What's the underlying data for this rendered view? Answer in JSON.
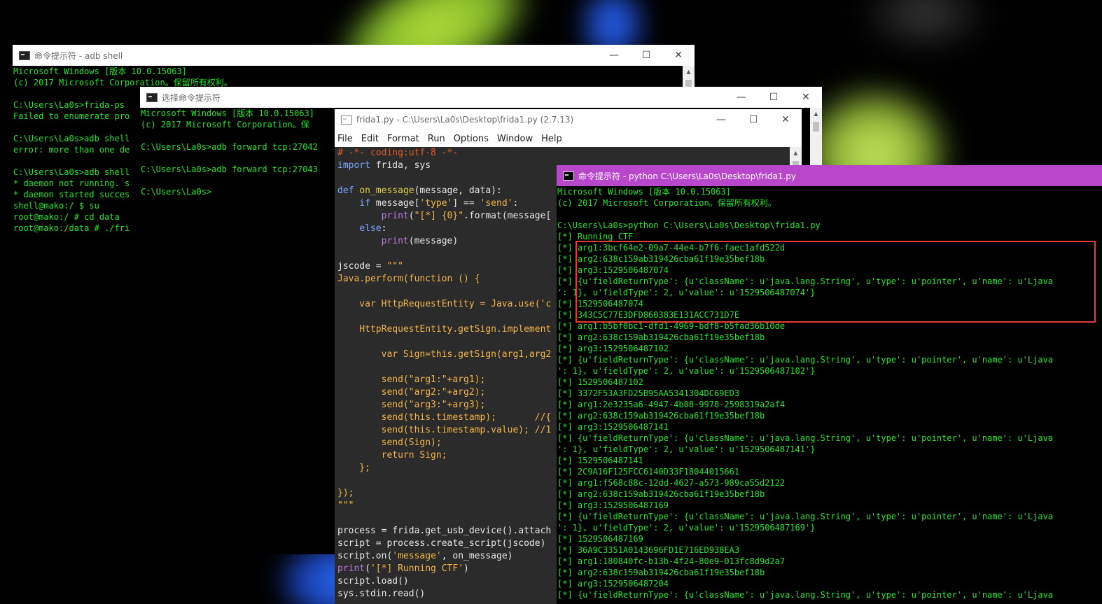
{
  "windows": {
    "adb": {
      "title": "命令提示符 - adb  shell",
      "lines": [
        "Microsoft Windows [版本 10.0.15063]",
        "(c) 2017 Microsoft Corporation。保留所有权利。",
        "",
        "C:\\Users\\La0s>frida-ps",
        "Failed to enumerate pro",
        "",
        "C:\\Users\\La0s>adb shell",
        "error: more than one de",
        "",
        "C:\\Users\\La0s>adb shell",
        "* daemon not running. s",
        "* daemon started succes",
        "shell@mako:/ $ su",
        "root@mako:/ # cd data",
        "root@mako:/data # ./fri"
      ]
    },
    "select": {
      "title": "选择命令提示符",
      "lines": [
        "Microsoft Windows [版本 10.0.15063]",
        "(c) 2017 Microsoft Corporation。保",
        "",
        "C:\\Users\\La0s>adb forward tcp:27042",
        "",
        "C:\\Users\\La0s>adb forward tcp:27043",
        "",
        "C:\\Users\\La0s>"
      ]
    },
    "idle": {
      "title": "frida1.py - C:\\Users\\La0s\\Desktop\\frida1.py (2.7.13)",
      "menu": [
        "File",
        "Edit",
        "Format",
        "Run",
        "Options",
        "Window",
        "Help"
      ]
    },
    "python": {
      "title": "命令提示符 - python  C:\\Users\\La0s\\Desktop\\frida1.py",
      "lines": [
        "Microsoft Windows [版本 10.0.15063]",
        "(c) 2017 Microsoft Corporation。保留所有权利。",
        "",
        "C:\\Users\\La0s>python C:\\Users\\La0s\\Desktop\\frida1.py",
        "[*] Running CTF",
        "[*] arg1:3bcf64e2-09a7-44e4-b7f6-faec1afd522d",
        "[*] arg2:638c159ab319426cba61f19e35bef18b",
        "[*] arg3:1529506487074",
        "[*] {u'fieldReturnType': {u'className': u'java.lang.String', u'type': u'pointer', u'name': u'Ljava",
        "': 1}, u'fieldType': 2, u'value': u'1529506487074'}",
        "[*] 1529506487074",
        "[*] 343C5C77E3DFD860383E131ACC731D7E",
        "[*] arg1:b5bf0bc1-dfd1-4969-bdf8-b5fad36b10de",
        "[*] arg2:638c159ab319426cba61f19e35bef18b",
        "[*] arg3:1529506487102",
        "[*] {u'fieldReturnType': {u'className': u'java.lang.String', u'type': u'pointer', u'name': u'Ljava",
        "': 1}, u'fieldType': 2, u'value': u'1529506487102'}",
        "[*] 1529506487102",
        "[*] 3372F53A3FD25B95AA5341304DC69ED3",
        "[*] arg1:2e3235a6-4947-4b08-9978-2598319a2af4",
        "[*] arg2:638c159ab319426cba61f19e35bef18b",
        "[*] arg3:1529506487141",
        "[*] {u'fieldReturnType': {u'className': u'java.lang.String', u'type': u'pointer', u'name': u'Ljava",
        "': 1}, u'fieldType': 2, u'value': u'1529506487141'}",
        "[*] 1529506487141",
        "[*] 2C9A16F125FCC6140D33F18044015661",
        "[*] arg1:f568c88c-12dd-4627-a573-989ca55d2122",
        "[*] arg2:638c159ab319426cba61f19e35bef18b",
        "[*] arg3:1529506487169",
        "[*] {u'fieldReturnType': {u'className': u'java.lang.String', u'type': u'pointer', u'name': u'Ljava",
        "': 1}, u'fieldType': 2, u'value': u'1529506487169'}",
        "[*] 1529506487169",
        "[*] 36A9C3351A0143696FD1E716ED938EA3",
        "[*] arg1:180840fc-b13b-4f24-80e9-013fc8d9d2a7",
        "[*] arg2:638c159ab319426cba61f19e35bef18b",
        "[*] arg3:1529506487204",
        "[*] {u'fieldReturnType': {u'className': u'java.lang.String', u'type': u'pointer', u'name': u'Ljava"
      ]
    }
  },
  "code": {
    "l1": "# -*- coding:utf-8 -*-",
    "l2a": "import",
    "l2b": " frida, sys",
    "l4a": "def ",
    "l4b": "on_message",
    "l4c": "(message, data):",
    "l5a": "    if ",
    "l5b": "message[",
    "l5c": "'type'",
    "l5d": "] == ",
    "l5e": "'send'",
    "l5f": ":",
    "l6a": "        ",
    "l6b": "print",
    "l6c": "(",
    "l6d": "\"[*] {0}\"",
    "l6e": ".format(message[",
    "l7a": "    ",
    "l7b": "else",
    "l7c": ":",
    "l8a": "        ",
    "l8b": "print",
    "l8c": "(message)",
    "l10a": "jscode = ",
    "l10b": "\"\"\"",
    "l11": "Java.perform(function () {",
    "l13": "    var HttpRequestEntity = Java.use('c",
    "l15": "    HttpRequestEntity.getSign.implement",
    "l17": "        var Sign=this.getSign(arg1,arg2",
    "l19": "        send(\"arg1:\"+arg1);",
    "l20": "        send(\"arg2:\"+arg2);",
    "l21": "        send(\"arg3:\"+arg3);",
    "l22": "        send(this.timestamp);       //{",
    "l23": "        send(this.timestamp.value); //1",
    "l24": "        send(Sign);",
    "l25": "        return Sign;",
    "l26": "    };",
    "l28": "});",
    "l29": "\"\"\"",
    "l31": "process = frida.get_usb_device().attach",
    "l32": "script = process.create_script(jscode)",
    "l33a": "script.on(",
    "l33b": "'message'",
    "l33c": ", on_message)",
    "l34a": "print",
    "l34b": "(",
    "l34c": "'[*] Running CTF'",
    "l34d": ")",
    "l35": "script.load()",
    "l36": "sys.stdin.read()"
  },
  "controls": {
    "minimize": "—",
    "maximize": "☐",
    "close": "✕",
    "scroll_up": "▲",
    "scroll_down": "▼"
  },
  "colors": {
    "console_text": "#22e52a",
    "python_titlebar": "#b847cc",
    "highlight": "#e53935"
  }
}
